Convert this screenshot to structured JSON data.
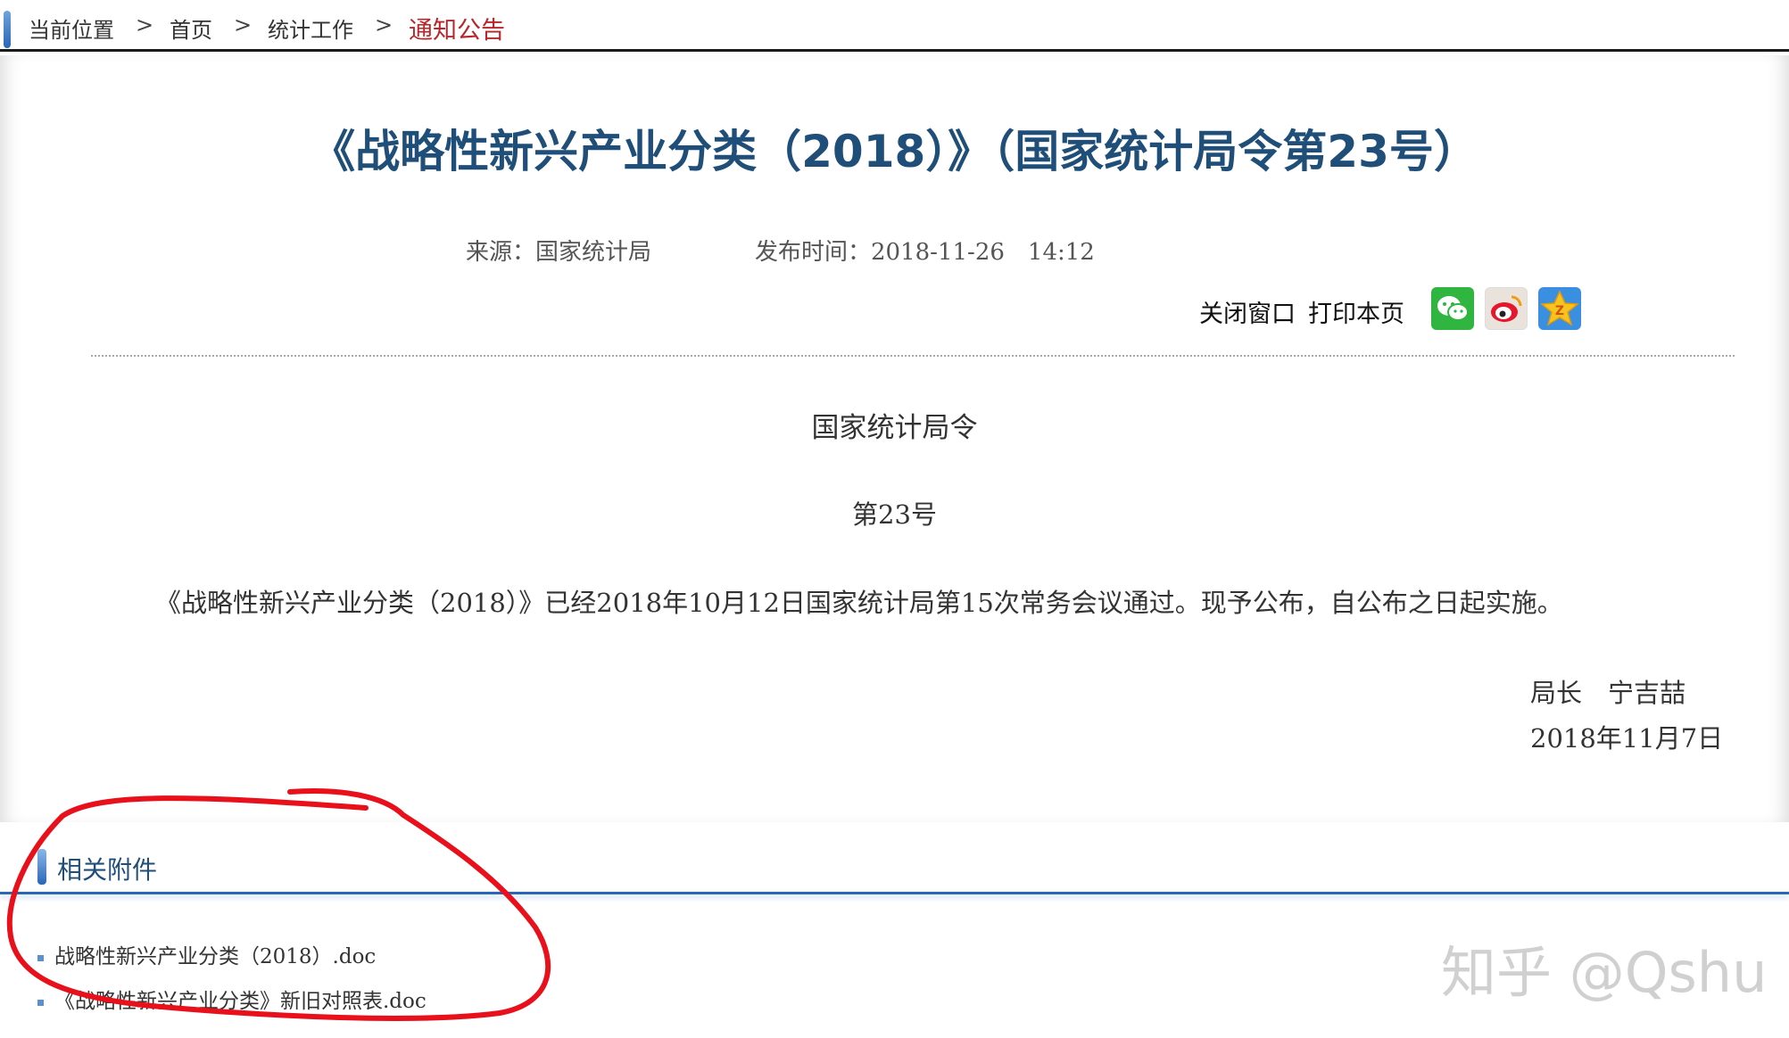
{
  "breadcrumb": {
    "location_label": "当前位置",
    "items": [
      "首页",
      "统计工作",
      "通知公告"
    ],
    "separator": ">"
  },
  "article": {
    "title": "《战略性新兴产业分类（2018）》（国家统计局令第23号）",
    "source_label": "来源：",
    "source": "国家统计局",
    "published_label": "发布时间：",
    "published": "2018-11-26　14:12",
    "close_window": "关闭窗口",
    "print_page": "打印本页",
    "order_title": "国家统计局令",
    "order_number": "第23号",
    "paragraph": "《战略性新兴产业分类（2018）》已经2018年10月12日国家统计局第15次常务会议通过。现予公布，自公布之日起实施。",
    "signature": "局长　宁吉喆",
    "signed_date": "2018年11月7日"
  },
  "attachments": {
    "heading": "相关附件",
    "files": [
      "战略性新兴产业分类（2018）.doc",
      "《战略性新兴产业分类》新旧对照表.doc"
    ]
  },
  "share_icons": [
    "wechat-icon",
    "weibo-icon",
    "qzone-icon"
  ],
  "watermark": "知乎 @Qshu",
  "colors": {
    "title_blue": "#1f4e79",
    "accent_blue": "#2a66b8",
    "current_crumb_red": "#b8262a",
    "annotation_red": "#e8101a"
  }
}
